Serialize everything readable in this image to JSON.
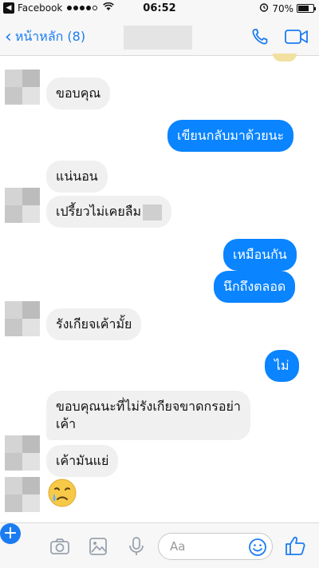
{
  "status_bar": {
    "carrier": "Facebook",
    "time": "06:52",
    "battery": "70%",
    "battery_level": 0.7
  },
  "nav": {
    "back_label": "หน้าหลัก (8)"
  },
  "messages": [
    {
      "side": "in",
      "text": "ขอบคุณ"
    },
    {
      "side": "out",
      "text": "เขียนกลับมาด้วยนะ"
    },
    {
      "side": "in",
      "text": "แน่นอน"
    },
    {
      "side": "in",
      "text": "เปรี้ยวไม่เคยลืม"
    },
    {
      "side": "out",
      "text": "เหมือนกัน"
    },
    {
      "side": "out",
      "text": "นึกถึงตลอด"
    },
    {
      "side": "in",
      "text": "รังเกียจเค้ามั้ย"
    },
    {
      "side": "out",
      "text": "ไม่"
    },
    {
      "side": "in",
      "text": "ขอบคุณนะที่ไม่รังเกียจขาดกรอย่า"
    },
    {
      "side": "in",
      "text": "เค้า"
    },
    {
      "side": "in",
      "text": "เค้ามันแย่"
    }
  ],
  "composer": {
    "placeholder": "Aa"
  },
  "colors": {
    "accent": "#1b7cf2",
    "outgoing_bubble": "#0a84ff",
    "incoming_bubble": "#f0f0f0"
  },
  "icons": [
    "back-icon",
    "wifi-icon",
    "alarm-icon",
    "battery-icon",
    "chevron-left-icon",
    "phone-icon",
    "video-camera-icon",
    "plus-icon",
    "camera-icon",
    "image-icon",
    "microphone-icon",
    "smiley-icon",
    "thumbs-up-icon",
    "crying-emoji-icon"
  ]
}
